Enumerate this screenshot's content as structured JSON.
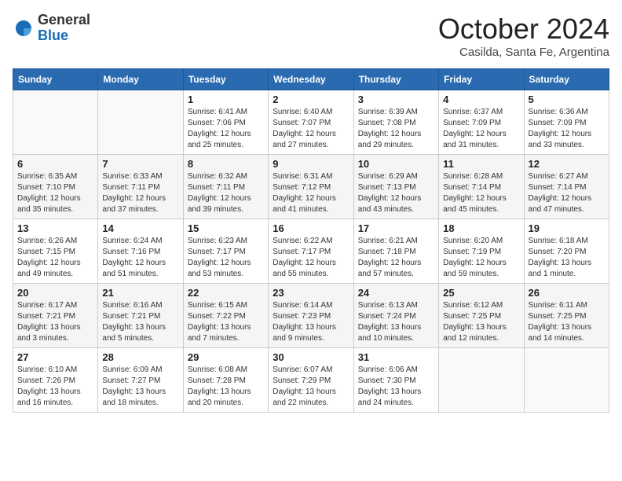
{
  "header": {
    "logo_general": "General",
    "logo_blue": "Blue",
    "month_title": "October 2024",
    "subtitle": "Casilda, Santa Fe, Argentina"
  },
  "days_of_week": [
    "Sunday",
    "Monday",
    "Tuesday",
    "Wednesday",
    "Thursday",
    "Friday",
    "Saturday"
  ],
  "weeks": [
    [
      {
        "day": "",
        "sunrise": "",
        "sunset": "",
        "daylight": ""
      },
      {
        "day": "",
        "sunrise": "",
        "sunset": "",
        "daylight": ""
      },
      {
        "day": "1",
        "sunrise": "Sunrise: 6:41 AM",
        "sunset": "Sunset: 7:06 PM",
        "daylight": "Daylight: 12 hours and 25 minutes."
      },
      {
        "day": "2",
        "sunrise": "Sunrise: 6:40 AM",
        "sunset": "Sunset: 7:07 PM",
        "daylight": "Daylight: 12 hours and 27 minutes."
      },
      {
        "day": "3",
        "sunrise": "Sunrise: 6:39 AM",
        "sunset": "Sunset: 7:08 PM",
        "daylight": "Daylight: 12 hours and 29 minutes."
      },
      {
        "day": "4",
        "sunrise": "Sunrise: 6:37 AM",
        "sunset": "Sunset: 7:09 PM",
        "daylight": "Daylight: 12 hours and 31 minutes."
      },
      {
        "day": "5",
        "sunrise": "Sunrise: 6:36 AM",
        "sunset": "Sunset: 7:09 PM",
        "daylight": "Daylight: 12 hours and 33 minutes."
      }
    ],
    [
      {
        "day": "6",
        "sunrise": "Sunrise: 6:35 AM",
        "sunset": "Sunset: 7:10 PM",
        "daylight": "Daylight: 12 hours and 35 minutes."
      },
      {
        "day": "7",
        "sunrise": "Sunrise: 6:33 AM",
        "sunset": "Sunset: 7:11 PM",
        "daylight": "Daylight: 12 hours and 37 minutes."
      },
      {
        "day": "8",
        "sunrise": "Sunrise: 6:32 AM",
        "sunset": "Sunset: 7:11 PM",
        "daylight": "Daylight: 12 hours and 39 minutes."
      },
      {
        "day": "9",
        "sunrise": "Sunrise: 6:31 AM",
        "sunset": "Sunset: 7:12 PM",
        "daylight": "Daylight: 12 hours and 41 minutes."
      },
      {
        "day": "10",
        "sunrise": "Sunrise: 6:29 AM",
        "sunset": "Sunset: 7:13 PM",
        "daylight": "Daylight: 12 hours and 43 minutes."
      },
      {
        "day": "11",
        "sunrise": "Sunrise: 6:28 AM",
        "sunset": "Sunset: 7:14 PM",
        "daylight": "Daylight: 12 hours and 45 minutes."
      },
      {
        "day": "12",
        "sunrise": "Sunrise: 6:27 AM",
        "sunset": "Sunset: 7:14 PM",
        "daylight": "Daylight: 12 hours and 47 minutes."
      }
    ],
    [
      {
        "day": "13",
        "sunrise": "Sunrise: 6:26 AM",
        "sunset": "Sunset: 7:15 PM",
        "daylight": "Daylight: 12 hours and 49 minutes."
      },
      {
        "day": "14",
        "sunrise": "Sunrise: 6:24 AM",
        "sunset": "Sunset: 7:16 PM",
        "daylight": "Daylight: 12 hours and 51 minutes."
      },
      {
        "day": "15",
        "sunrise": "Sunrise: 6:23 AM",
        "sunset": "Sunset: 7:17 PM",
        "daylight": "Daylight: 12 hours and 53 minutes."
      },
      {
        "day": "16",
        "sunrise": "Sunrise: 6:22 AM",
        "sunset": "Sunset: 7:17 PM",
        "daylight": "Daylight: 12 hours and 55 minutes."
      },
      {
        "day": "17",
        "sunrise": "Sunrise: 6:21 AM",
        "sunset": "Sunset: 7:18 PM",
        "daylight": "Daylight: 12 hours and 57 minutes."
      },
      {
        "day": "18",
        "sunrise": "Sunrise: 6:20 AM",
        "sunset": "Sunset: 7:19 PM",
        "daylight": "Daylight: 12 hours and 59 minutes."
      },
      {
        "day": "19",
        "sunrise": "Sunrise: 6:18 AM",
        "sunset": "Sunset: 7:20 PM",
        "daylight": "Daylight: 13 hours and 1 minute."
      }
    ],
    [
      {
        "day": "20",
        "sunrise": "Sunrise: 6:17 AM",
        "sunset": "Sunset: 7:21 PM",
        "daylight": "Daylight: 13 hours and 3 minutes."
      },
      {
        "day": "21",
        "sunrise": "Sunrise: 6:16 AM",
        "sunset": "Sunset: 7:21 PM",
        "daylight": "Daylight: 13 hours and 5 minutes."
      },
      {
        "day": "22",
        "sunrise": "Sunrise: 6:15 AM",
        "sunset": "Sunset: 7:22 PM",
        "daylight": "Daylight: 13 hours and 7 minutes."
      },
      {
        "day": "23",
        "sunrise": "Sunrise: 6:14 AM",
        "sunset": "Sunset: 7:23 PM",
        "daylight": "Daylight: 13 hours and 9 minutes."
      },
      {
        "day": "24",
        "sunrise": "Sunrise: 6:13 AM",
        "sunset": "Sunset: 7:24 PM",
        "daylight": "Daylight: 13 hours and 10 minutes."
      },
      {
        "day": "25",
        "sunrise": "Sunrise: 6:12 AM",
        "sunset": "Sunset: 7:25 PM",
        "daylight": "Daylight: 13 hours and 12 minutes."
      },
      {
        "day": "26",
        "sunrise": "Sunrise: 6:11 AM",
        "sunset": "Sunset: 7:25 PM",
        "daylight": "Daylight: 13 hours and 14 minutes."
      }
    ],
    [
      {
        "day": "27",
        "sunrise": "Sunrise: 6:10 AM",
        "sunset": "Sunset: 7:26 PM",
        "daylight": "Daylight: 13 hours and 16 minutes."
      },
      {
        "day": "28",
        "sunrise": "Sunrise: 6:09 AM",
        "sunset": "Sunset: 7:27 PM",
        "daylight": "Daylight: 13 hours and 18 minutes."
      },
      {
        "day": "29",
        "sunrise": "Sunrise: 6:08 AM",
        "sunset": "Sunset: 7:28 PM",
        "daylight": "Daylight: 13 hours and 20 minutes."
      },
      {
        "day": "30",
        "sunrise": "Sunrise: 6:07 AM",
        "sunset": "Sunset: 7:29 PM",
        "daylight": "Daylight: 13 hours and 22 minutes."
      },
      {
        "day": "31",
        "sunrise": "Sunrise: 6:06 AM",
        "sunset": "Sunset: 7:30 PM",
        "daylight": "Daylight: 13 hours and 24 minutes."
      },
      {
        "day": "",
        "sunrise": "",
        "sunset": "",
        "daylight": ""
      },
      {
        "day": "",
        "sunrise": "",
        "sunset": "",
        "daylight": ""
      }
    ]
  ]
}
